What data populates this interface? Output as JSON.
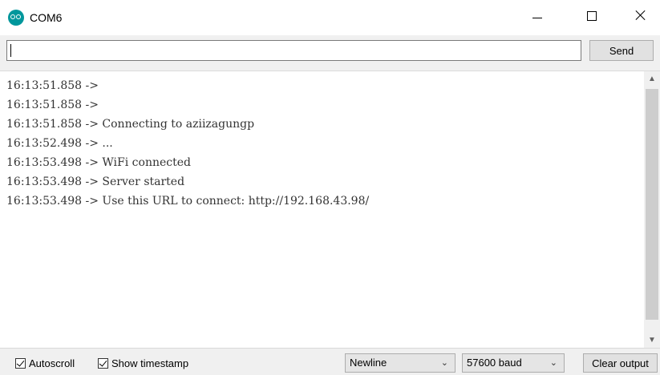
{
  "window": {
    "title": "COM6",
    "icon": "arduino-icon"
  },
  "input": {
    "value": "",
    "send_label": "Send"
  },
  "output": {
    "lines": [
      "16:13:51.858 -> ",
      "16:13:51.858 -> ",
      "16:13:51.858 -> Connecting to aziizagungp",
      "16:13:52.498 -> ...",
      "16:13:53.498 -> WiFi connected",
      "16:13:53.498 -> Server started",
      "16:13:53.498 -> Use this URL to connect: http://192.168.43.98/"
    ]
  },
  "bottombar": {
    "autoscroll_label": "Autoscroll",
    "autoscroll_checked": true,
    "timestamp_label": "Show timestamp",
    "timestamp_checked": true,
    "line_ending": "Newline",
    "baud_rate": "57600 baud",
    "clear_label": "Clear output"
  },
  "colors": {
    "accent": "#00979c"
  }
}
